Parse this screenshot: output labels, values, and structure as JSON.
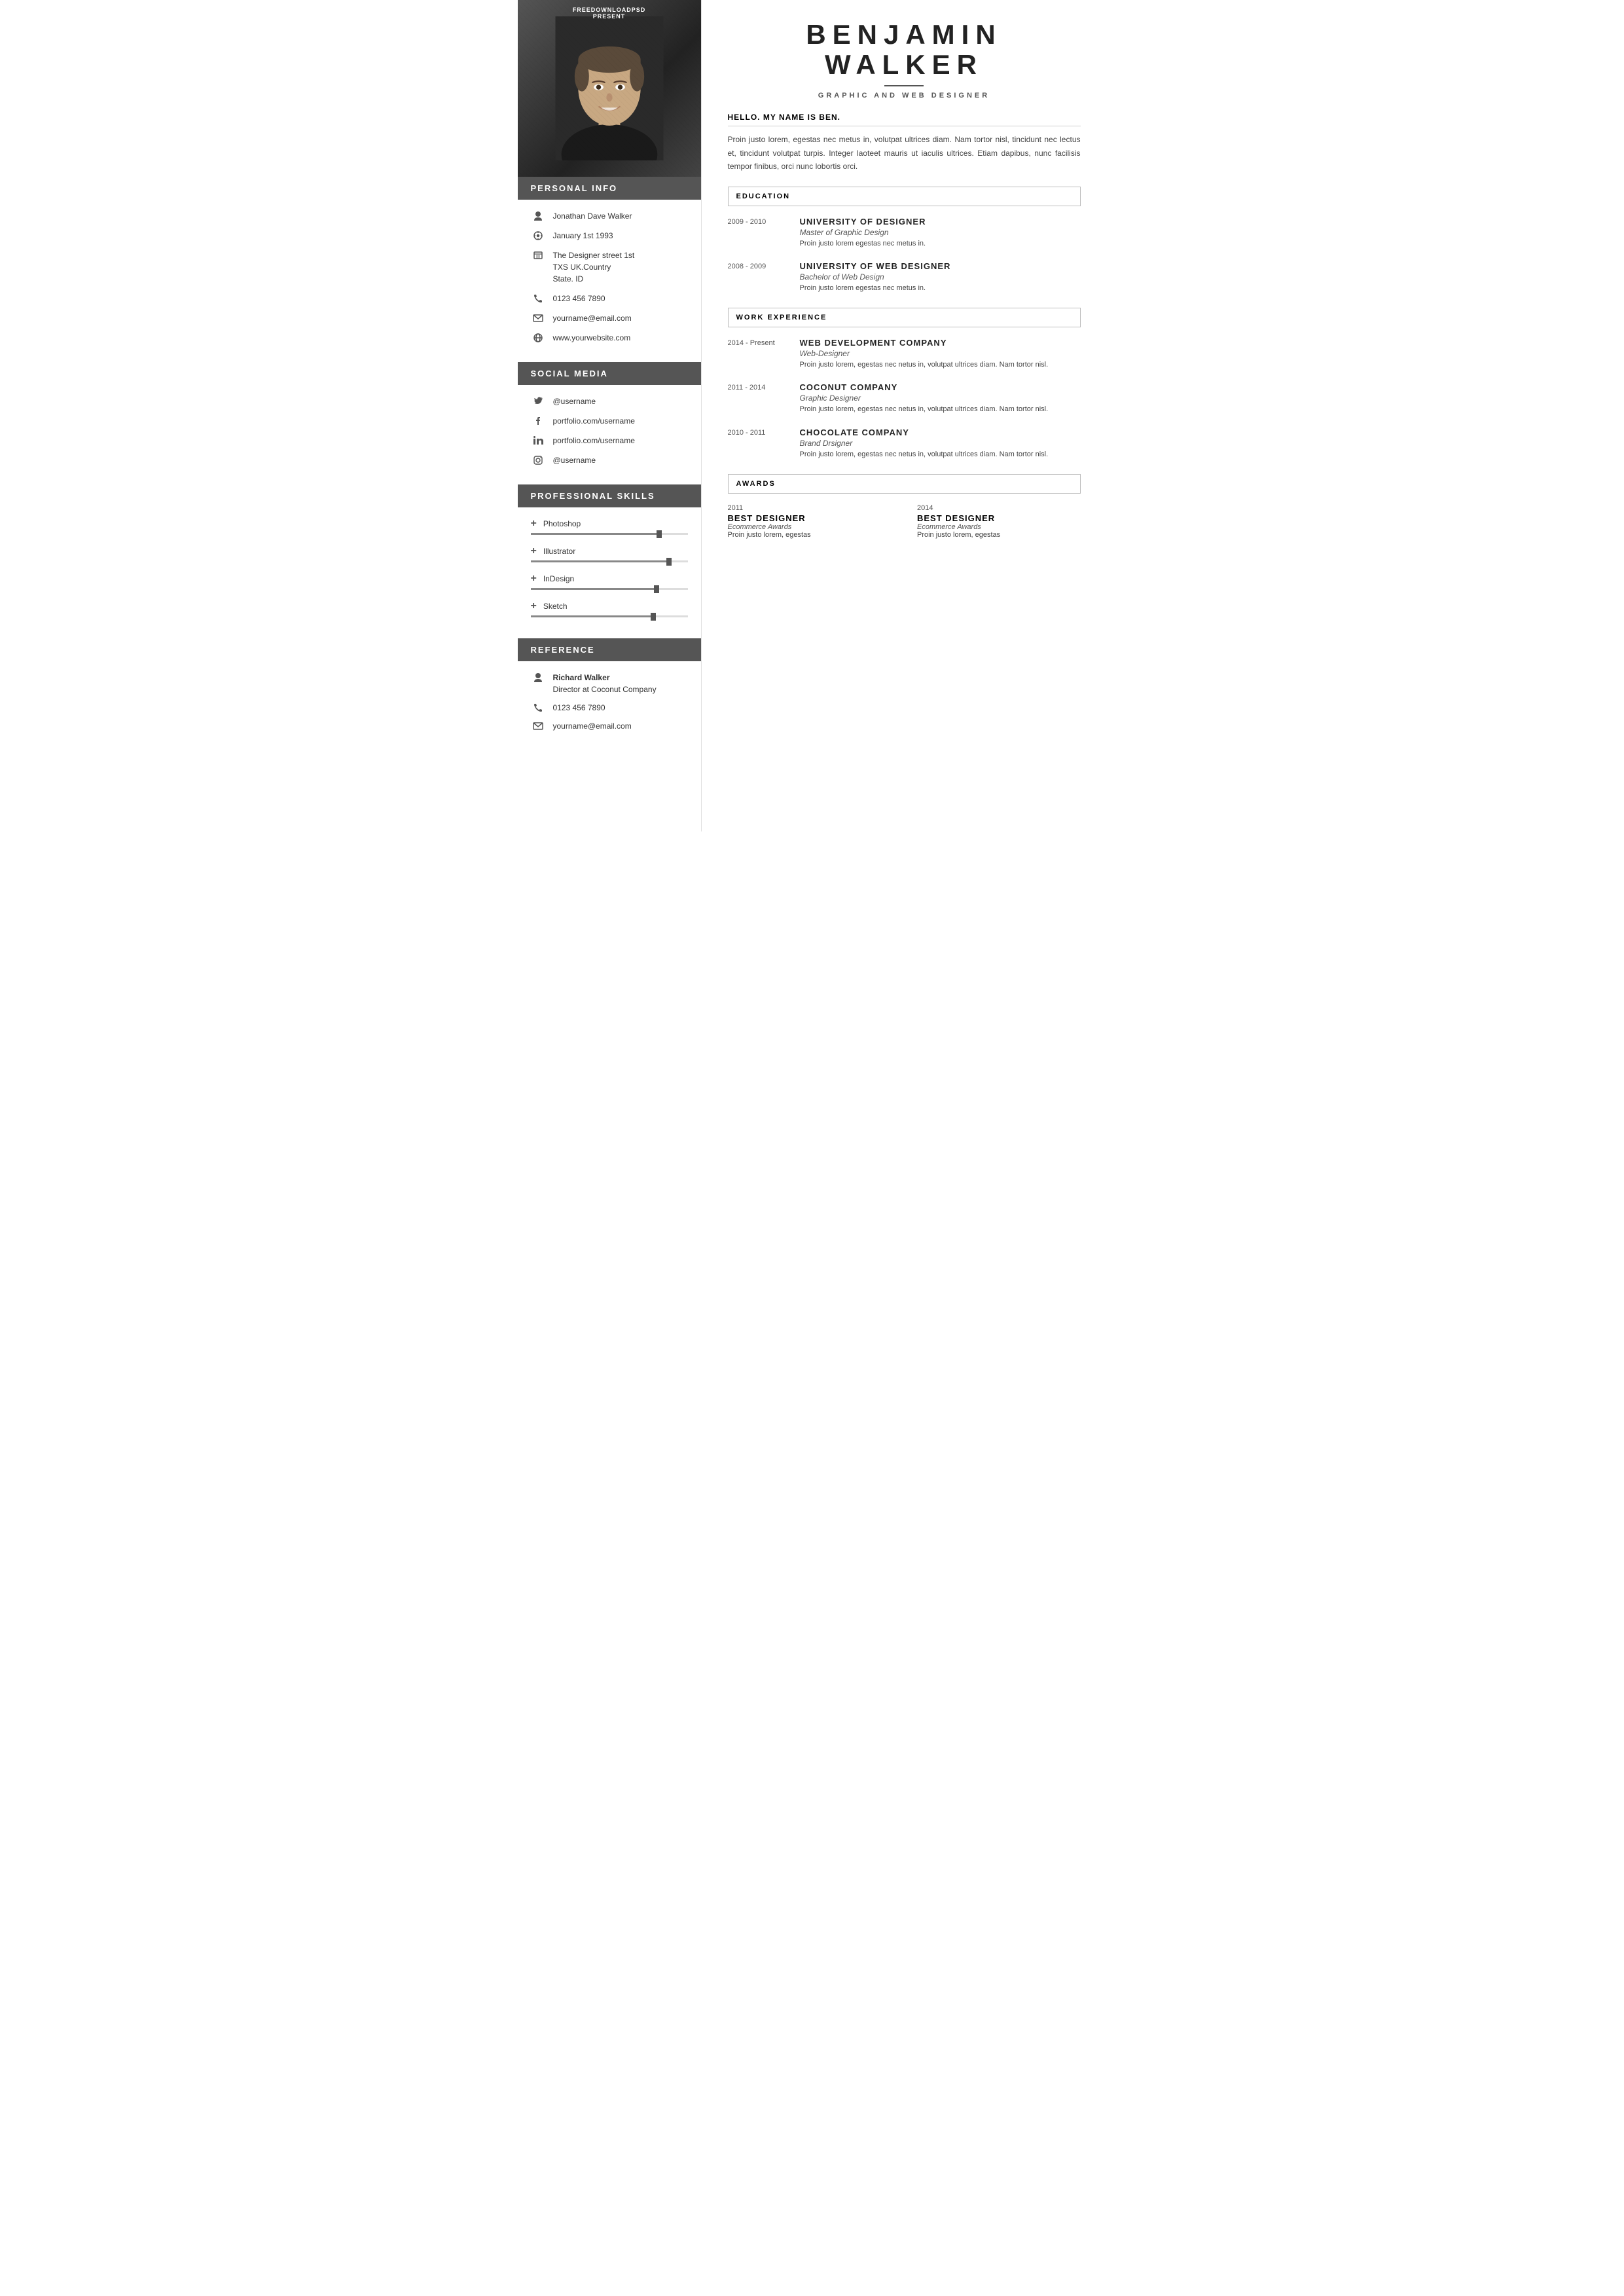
{
  "watermark": {
    "line1": "FREEDOWNLOADPSD",
    "line2": "PRESENT"
  },
  "sidebar": {
    "sections": {
      "personal_info": "PERSONAL INFO",
      "social_media": "SOCIAL MEDIA",
      "professional_skills": "PROFESSIONAL  SKILLS",
      "reference": "REFERENCE"
    },
    "personal": [
      {
        "icon": "person",
        "text": "Jonathan Dave Walker"
      },
      {
        "icon": "sun",
        "text": "January 1st 1993"
      },
      {
        "icon": "address",
        "text": "The Designer street 1st\nTXS UK.Country\nState. ID"
      },
      {
        "icon": "phone",
        "text": "0123 456 7890"
      },
      {
        "icon": "email",
        "text": "yourname@email.com"
      },
      {
        "icon": "globe",
        "text": "www.yourwebsite.com"
      }
    ],
    "social": [
      {
        "icon": "twitter",
        "text": "@username"
      },
      {
        "icon": "facebook",
        "text": "portfolio.com/username"
      },
      {
        "icon": "linkedin",
        "text": "portfolio.com/username"
      },
      {
        "icon": "instagram",
        "text": "@username"
      }
    ],
    "skills": [
      {
        "label": "Photoshop",
        "percent": 82
      },
      {
        "label": "Illustrator",
        "percent": 88
      },
      {
        "label": "InDesign",
        "percent": 80
      },
      {
        "label": "Sketch",
        "percent": 78
      }
    ],
    "reference": {
      "name": "Richard Walker",
      "role": "Director at Coconut Company",
      "phone": "0123 456 7890",
      "email": "yourname@email.com"
    }
  },
  "main": {
    "name_line1": "BENJAMIN",
    "name_line2": "WALKER",
    "subtitle": "GRAPHIC AND WEB DESIGNER",
    "greeting": "HELLO. MY NAME IS BEN.",
    "intro": "Proin justo lorem, egestas nec metus in, volutpat ultrices diam. Nam tortor nisl, tincidunt nec lectus et, tincidunt volutpat turpis. Integer laoteet mauris ut iaculis ultrices. Etiam dapibus, nunc facilisis tempor finibus, orci nunc lobortis orci.",
    "education_title": "EDUCATION",
    "education": [
      {
        "date": "2009 - 2010",
        "company": "UNIVERSITY OF DESIGNER",
        "role": "Master of Graphic Design",
        "desc": "Proin justo lorem egestas nec metus in."
      },
      {
        "date": "2008 - 2009",
        "company": "UNIVERSITY OF WEB DESIGNER",
        "role": "Bachelor of Web Design",
        "desc": "Proin justo lorem egestas nec metus in."
      }
    ],
    "work_title": "WORK EXPERIENCE",
    "work": [
      {
        "date": "2014 - Present",
        "company": "WEB DEVELOPMENT COMPANY",
        "role": "Web-Designer",
        "desc": "Proin justo lorem, egestas nec netus in, volutpat ultrices diam. Nam tortor nisl."
      },
      {
        "date": "2011 - 2014",
        "company": "COCONUT COMPANY",
        "role": "Graphic Designer",
        "desc": "Proin justo lorem, egestas nec netus in, volutpat ultrices diam. Nam tortor nisl."
      },
      {
        "date": "2010 - 2011",
        "company": "CHOCOLATE  COMPANY",
        "role": "Brand Drsigner",
        "desc": "Proin justo lorem, egestas nec netus in, volutpat ultrices diam. Nam tortor nisl."
      }
    ],
    "awards_title": "AWARDS",
    "awards": [
      {
        "year": "2011",
        "title": "BEST  DESIGNER",
        "org": "Ecommerce Awards",
        "desc": "Proin justo  lorem, egestas"
      },
      {
        "year": "2014",
        "title": "BEST  DESIGNER",
        "org": "Ecommerce Awards",
        "desc": "Proin justo  lorem, egestas"
      }
    ]
  }
}
